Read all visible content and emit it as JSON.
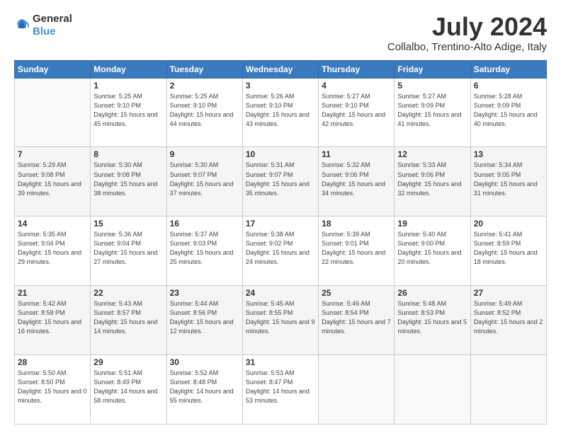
{
  "header": {
    "logo_general": "General",
    "logo_blue": "Blue",
    "month_year": "July 2024",
    "location": "Collalbo, Trentino-Alto Adige, Italy"
  },
  "weekdays": [
    "Sunday",
    "Monday",
    "Tuesday",
    "Wednesday",
    "Thursday",
    "Friday",
    "Saturday"
  ],
  "weeks": [
    [
      {
        "day": "",
        "sunrise": "",
        "sunset": "",
        "daylight": ""
      },
      {
        "day": "1",
        "sunrise": "Sunrise: 5:25 AM",
        "sunset": "Sunset: 9:10 PM",
        "daylight": "Daylight: 15 hours and 45 minutes."
      },
      {
        "day": "2",
        "sunrise": "Sunrise: 5:25 AM",
        "sunset": "Sunset: 9:10 PM",
        "daylight": "Daylight: 15 hours and 44 minutes."
      },
      {
        "day": "3",
        "sunrise": "Sunrise: 5:26 AM",
        "sunset": "Sunset: 9:10 PM",
        "daylight": "Daylight: 15 hours and 43 minutes."
      },
      {
        "day": "4",
        "sunrise": "Sunrise: 5:27 AM",
        "sunset": "Sunset: 9:10 PM",
        "daylight": "Daylight: 15 hours and 42 minutes."
      },
      {
        "day": "5",
        "sunrise": "Sunrise: 5:27 AM",
        "sunset": "Sunset: 9:09 PM",
        "daylight": "Daylight: 15 hours and 41 minutes."
      },
      {
        "day": "6",
        "sunrise": "Sunrise: 5:28 AM",
        "sunset": "Sunset: 9:09 PM",
        "daylight": "Daylight: 15 hours and 40 minutes."
      }
    ],
    [
      {
        "day": "7",
        "sunrise": "Sunrise: 5:29 AM",
        "sunset": "Sunset: 9:08 PM",
        "daylight": "Daylight: 15 hours and 39 minutes."
      },
      {
        "day": "8",
        "sunrise": "Sunrise: 5:30 AM",
        "sunset": "Sunset: 9:08 PM",
        "daylight": "Daylight: 15 hours and 38 minutes."
      },
      {
        "day": "9",
        "sunrise": "Sunrise: 5:30 AM",
        "sunset": "Sunset: 9:07 PM",
        "daylight": "Daylight: 15 hours and 37 minutes."
      },
      {
        "day": "10",
        "sunrise": "Sunrise: 5:31 AM",
        "sunset": "Sunset: 9:07 PM",
        "daylight": "Daylight: 15 hours and 35 minutes."
      },
      {
        "day": "11",
        "sunrise": "Sunrise: 5:32 AM",
        "sunset": "Sunset: 9:06 PM",
        "daylight": "Daylight: 15 hours and 34 minutes."
      },
      {
        "day": "12",
        "sunrise": "Sunrise: 5:33 AM",
        "sunset": "Sunset: 9:06 PM",
        "daylight": "Daylight: 15 hours and 32 minutes."
      },
      {
        "day": "13",
        "sunrise": "Sunrise: 5:34 AM",
        "sunset": "Sunset: 9:05 PM",
        "daylight": "Daylight: 15 hours and 31 minutes."
      }
    ],
    [
      {
        "day": "14",
        "sunrise": "Sunrise: 5:35 AM",
        "sunset": "Sunset: 9:04 PM",
        "daylight": "Daylight: 15 hours and 29 minutes."
      },
      {
        "day": "15",
        "sunrise": "Sunrise: 5:36 AM",
        "sunset": "Sunset: 9:04 PM",
        "daylight": "Daylight: 15 hours and 27 minutes."
      },
      {
        "day": "16",
        "sunrise": "Sunrise: 5:37 AM",
        "sunset": "Sunset: 9:03 PM",
        "daylight": "Daylight: 15 hours and 25 minutes."
      },
      {
        "day": "17",
        "sunrise": "Sunrise: 5:38 AM",
        "sunset": "Sunset: 9:02 PM",
        "daylight": "Daylight: 15 hours and 24 minutes."
      },
      {
        "day": "18",
        "sunrise": "Sunrise: 5:39 AM",
        "sunset": "Sunset: 9:01 PM",
        "daylight": "Daylight: 15 hours and 22 minutes."
      },
      {
        "day": "19",
        "sunrise": "Sunrise: 5:40 AM",
        "sunset": "Sunset: 9:00 PM",
        "daylight": "Daylight: 15 hours and 20 minutes."
      },
      {
        "day": "20",
        "sunrise": "Sunrise: 5:41 AM",
        "sunset": "Sunset: 8:59 PM",
        "daylight": "Daylight: 15 hours and 18 minutes."
      }
    ],
    [
      {
        "day": "21",
        "sunrise": "Sunrise: 5:42 AM",
        "sunset": "Sunset: 8:58 PM",
        "daylight": "Daylight: 15 hours and 16 minutes."
      },
      {
        "day": "22",
        "sunrise": "Sunrise: 5:43 AM",
        "sunset": "Sunset: 8:57 PM",
        "daylight": "Daylight: 15 hours and 14 minutes."
      },
      {
        "day": "23",
        "sunrise": "Sunrise: 5:44 AM",
        "sunset": "Sunset: 8:56 PM",
        "daylight": "Daylight: 15 hours and 12 minutes."
      },
      {
        "day": "24",
        "sunrise": "Sunrise: 5:45 AM",
        "sunset": "Sunset: 8:55 PM",
        "daylight": "Daylight: 15 hours and 9 minutes."
      },
      {
        "day": "25",
        "sunrise": "Sunrise: 5:46 AM",
        "sunset": "Sunset: 8:54 PM",
        "daylight": "Daylight: 15 hours and 7 minutes."
      },
      {
        "day": "26",
        "sunrise": "Sunrise: 5:48 AM",
        "sunset": "Sunset: 8:53 PM",
        "daylight": "Daylight: 15 hours and 5 minutes."
      },
      {
        "day": "27",
        "sunrise": "Sunrise: 5:49 AM",
        "sunset": "Sunset: 8:52 PM",
        "daylight": "Daylight: 15 hours and 2 minutes."
      }
    ],
    [
      {
        "day": "28",
        "sunrise": "Sunrise: 5:50 AM",
        "sunset": "Sunset: 8:50 PM",
        "daylight": "Daylight: 15 hours and 0 minutes."
      },
      {
        "day": "29",
        "sunrise": "Sunrise: 5:51 AM",
        "sunset": "Sunset: 8:49 PM",
        "daylight": "Daylight: 14 hours and 58 minutes."
      },
      {
        "day": "30",
        "sunrise": "Sunrise: 5:52 AM",
        "sunset": "Sunset: 8:48 PM",
        "daylight": "Daylight: 14 hours and 55 minutes."
      },
      {
        "day": "31",
        "sunrise": "Sunrise: 5:53 AM",
        "sunset": "Sunset: 8:47 PM",
        "daylight": "Daylight: 14 hours and 53 minutes."
      },
      {
        "day": "",
        "sunrise": "",
        "sunset": "",
        "daylight": ""
      },
      {
        "day": "",
        "sunrise": "",
        "sunset": "",
        "daylight": ""
      },
      {
        "day": "",
        "sunrise": "",
        "sunset": "",
        "daylight": ""
      }
    ]
  ]
}
